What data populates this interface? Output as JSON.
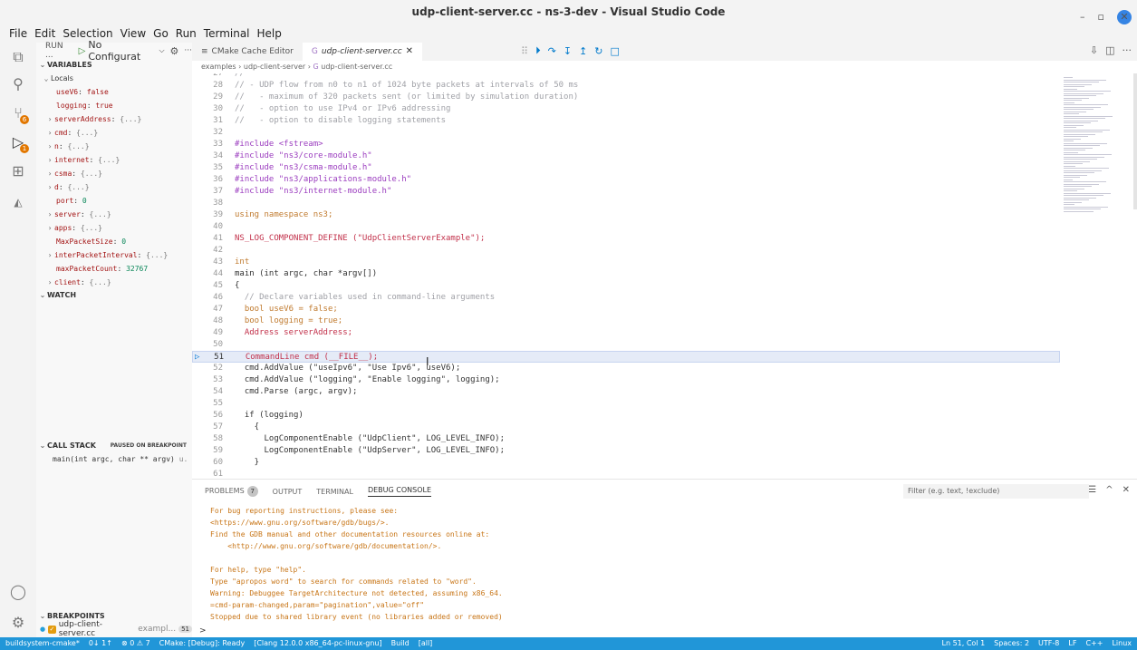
{
  "window": {
    "title": "udp-client-server.cc - ns-3-dev - Visual Studio Code",
    "minimize": "–",
    "maximize": "▫",
    "close": "✕"
  },
  "menu": [
    "File",
    "Edit",
    "Selection",
    "View",
    "Go",
    "Run",
    "Terminal",
    "Help"
  ],
  "activity": {
    "scm_badge": "6",
    "debug_badge": "1"
  },
  "sidebar": {
    "run_label": "RUN ...",
    "config": "No Configurat",
    "variables_title": "VARIABLES",
    "locals_label": "Locals",
    "variables": [
      {
        "name": "useV6",
        "sep": ": ",
        "value": "false",
        "kind": "str",
        "expandable": false
      },
      {
        "name": "logging",
        "sep": ": ",
        "value": "true",
        "kind": "str",
        "expandable": false
      },
      {
        "name": "serverAddress",
        "sep": ": ",
        "value": "{...}",
        "kind": "obj",
        "expandable": true
      },
      {
        "name": "cmd",
        "sep": ": ",
        "value": "{...}",
        "kind": "obj",
        "expandable": true
      },
      {
        "name": "n",
        "sep": ": ",
        "value": "{...}",
        "kind": "obj",
        "expandable": true
      },
      {
        "name": "internet",
        "sep": ": ",
        "value": "{...}",
        "kind": "obj",
        "expandable": true
      },
      {
        "name": "csma",
        "sep": ": ",
        "value": "{...}",
        "kind": "obj",
        "expandable": true
      },
      {
        "name": "d",
        "sep": ": ",
        "value": "{...}",
        "kind": "obj",
        "expandable": true
      },
      {
        "name": "port",
        "sep": ": ",
        "value": "0",
        "kind": "num",
        "expandable": false
      },
      {
        "name": "server",
        "sep": ": ",
        "value": "{...}",
        "kind": "obj",
        "expandable": true
      },
      {
        "name": "apps",
        "sep": ": ",
        "value": "{...}",
        "kind": "obj",
        "expandable": true
      },
      {
        "name": "MaxPacketSize",
        "sep": ": ",
        "value": "0",
        "kind": "num",
        "expandable": false
      },
      {
        "name": "interPacketInterval",
        "sep": ": ",
        "value": "{...}",
        "kind": "obj",
        "expandable": true
      },
      {
        "name": "maxPacketCount",
        "sep": ": ",
        "value": "32767",
        "kind": "num",
        "expandable": false
      },
      {
        "name": "client",
        "sep": ": ",
        "value": "{...}",
        "kind": "obj",
        "expandable": true
      }
    ],
    "watch_title": "WATCH",
    "callstack_title": "CALL STACK",
    "callstack_status": "PAUSED ON BREAKPOINT",
    "callstack_frame": "main(int argc, char ** argv)",
    "callstack_file": "u.",
    "breakpoints_title": "BREAKPOINTS",
    "breakpoint_file": "udp-client-server.cc",
    "breakpoint_path": "exampl...",
    "breakpoint_line": "51"
  },
  "tabs": [
    {
      "label": "CMake Cache Editor",
      "active": false
    },
    {
      "label": "udp-client-server.cc",
      "active": true,
      "close": "✕"
    }
  ],
  "breadcrumb": [
    "examples",
    "udp-client-server",
    "udp-client-server.cc"
  ],
  "breadcrumb_sep": "›",
  "editor": {
    "current_line": 51,
    "lines": [
      {
        "n": "27",
        "t": "//",
        "k": "com"
      },
      {
        "n": "28",
        "t": "// - UDP flow from n0 to n1 of 1024 byte packets at intervals of 50 ms",
        "k": "com"
      },
      {
        "n": "29",
        "t": "//   - maximum of 320 packets sent (or limited by simulation duration)",
        "k": "com"
      },
      {
        "n": "30",
        "t": "//   - option to use IPv4 or IPv6 addressing",
        "k": "com"
      },
      {
        "n": "31",
        "t": "//   - option to disable logging statements",
        "k": "com"
      },
      {
        "n": "32",
        "t": "",
        "k": ""
      },
      {
        "n": "33",
        "t": "#include <fstream>",
        "k": "pp"
      },
      {
        "n": "34",
        "t": "#include \"ns3/core-module.h\"",
        "k": "pp"
      },
      {
        "n": "35",
        "t": "#include \"ns3/csma-module.h\"",
        "k": "pp"
      },
      {
        "n": "36",
        "t": "#include \"ns3/applications-module.h\"",
        "k": "pp"
      },
      {
        "n": "37",
        "t": "#include \"ns3/internet-module.h\"",
        "k": "pp"
      },
      {
        "n": "38",
        "t": "",
        "k": ""
      },
      {
        "n": "39",
        "t": "using namespace ns3;",
        "k": "kw"
      },
      {
        "n": "40",
        "t": "",
        "k": ""
      },
      {
        "n": "41",
        "t": "NS_LOG_COMPONENT_DEFINE (\"UdpClientServerExample\");",
        "k": "fn"
      },
      {
        "n": "42",
        "t": "",
        "k": ""
      },
      {
        "n": "43",
        "t": "int",
        "k": "kw"
      },
      {
        "n": "44",
        "t": "main (int argc, char *argv[])",
        "k": ""
      },
      {
        "n": "45",
        "t": "{",
        "k": ""
      },
      {
        "n": "46",
        "t": "  // Declare variables used in command-line arguments",
        "k": "com"
      },
      {
        "n": "47",
        "t": "  bool useV6 = false;",
        "k": "kw"
      },
      {
        "n": "48",
        "t": "  bool logging = true;",
        "k": "kw"
      },
      {
        "n": "49",
        "t": "  Address serverAddress;",
        "k": "fn"
      },
      {
        "n": "50",
        "t": "",
        "k": ""
      },
      {
        "n": "51",
        "t": "  CommandLine cmd (__FILE__);",
        "k": "fn"
      },
      {
        "n": "52",
        "t": "  cmd.AddValue (\"useIpv6\", \"Use Ipv6\", useV6);",
        "k": ""
      },
      {
        "n": "53",
        "t": "  cmd.AddValue (\"logging\", \"Enable logging\", logging);",
        "k": ""
      },
      {
        "n": "54",
        "t": "  cmd.Parse (argc, argv);",
        "k": ""
      },
      {
        "n": "55",
        "t": "",
        "k": ""
      },
      {
        "n": "56",
        "t": "  if (logging)",
        "k": ""
      },
      {
        "n": "57",
        "t": "    {",
        "k": ""
      },
      {
        "n": "58",
        "t": "      LogComponentEnable (\"UdpClient\", LOG_LEVEL_INFO);",
        "k": ""
      },
      {
        "n": "59",
        "t": "      LogComponentEnable (\"UdpServer\", LOG_LEVEL_INFO);",
        "k": ""
      },
      {
        "n": "60",
        "t": "    }",
        "k": ""
      },
      {
        "n": "61",
        "t": "",
        "k": ""
      }
    ]
  },
  "panel": {
    "tabs": [
      "PROBLEMS",
      "OUTPUT",
      "TERMINAL",
      "DEBUG CONSOLE"
    ],
    "problems_count": "7",
    "active_tab": "DEBUG CONSOLE",
    "filter_placeholder": "Filter (e.g. text, !exclude)",
    "console": [
      "For bug reporting instructions, please see:",
      "<https://www.gnu.org/software/gdb/bugs/>.",
      "Find the GDB manual and other documentation resources online at:",
      "    <http://www.gnu.org/software/gdb/documentation/>.",
      "",
      "For help, type \"help\".",
      "Type \"apropos word\" to search for commands related to \"word\".",
      "Warning: Debuggee TargetArchitecture not detected, assuming x86_64.",
      "=cmd-param-changed,param=\"pagination\",value=\"off\"",
      "Stopped due to shared library event (no libraries added or removed)"
    ],
    "prompt": ">"
  },
  "status": {
    "left": [
      "buildsystem-cmake*",
      "0↓ 1↑",
      "⊗ 0 ⚠ 7",
      "CMake: [Debug]: Ready",
      "[Clang 12.0.0 x86_64-pc-linux-gnu]",
      "Build",
      "[all]"
    ],
    "right": [
      "Ln 51, Col 1",
      "Spaces: 2",
      "UTF-8",
      "LF",
      "C++",
      "Linux"
    ]
  },
  "colors": {
    "statusbar": "#2196d8",
    "accent": "#007acc",
    "console_text": "#c87618"
  }
}
